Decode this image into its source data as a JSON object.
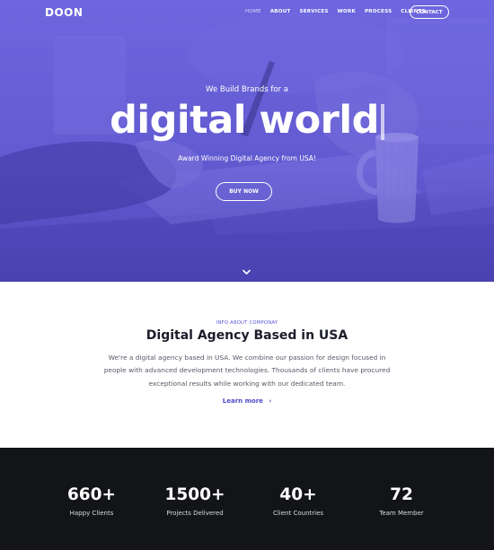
{
  "colors": {
    "accent": "#5b54d6",
    "hero_overlay": "#6b63d8",
    "dark_section": "#121418",
    "heading": "#1c1d2b",
    "body_text": "#555a66"
  },
  "nav": {
    "logo": "DOON",
    "items": [
      {
        "label": "HOME",
        "active": true
      },
      {
        "label": "ABOUT",
        "active": false
      },
      {
        "label": "SERVICES",
        "active": false
      },
      {
        "label": "WORK",
        "active": false
      },
      {
        "label": "PROCESS",
        "active": false
      },
      {
        "label": "CLIENTS",
        "active": false
      }
    ],
    "contact_label": "CONTACT"
  },
  "hero": {
    "kicker": "We Build Brands for a",
    "title": "digital world",
    "subtitle": "Award Winning Digital Agency from USA!",
    "cta_label": "BUY NOW",
    "scroll_icon": "chevron-down-icon"
  },
  "about": {
    "kicker": "INFO ABOUT COMPONAY",
    "title": "Digital Agency Based in USA",
    "text": "We're a digital agency based in USA. We combine our passion for design focused in people with advanced development technologies. Thousands of clients have procured exceptional results while working with our dedicated team.",
    "link_label": "Learn more",
    "link_icon": "chevron-right-icon"
  },
  "stats": [
    {
      "value": "660+",
      "label": "Happy Clients"
    },
    {
      "value": "1500+",
      "label": "Projects Delivered"
    },
    {
      "value": "40+",
      "label": "Client Countries"
    },
    {
      "value": "72",
      "label": "Team Member"
    }
  ]
}
